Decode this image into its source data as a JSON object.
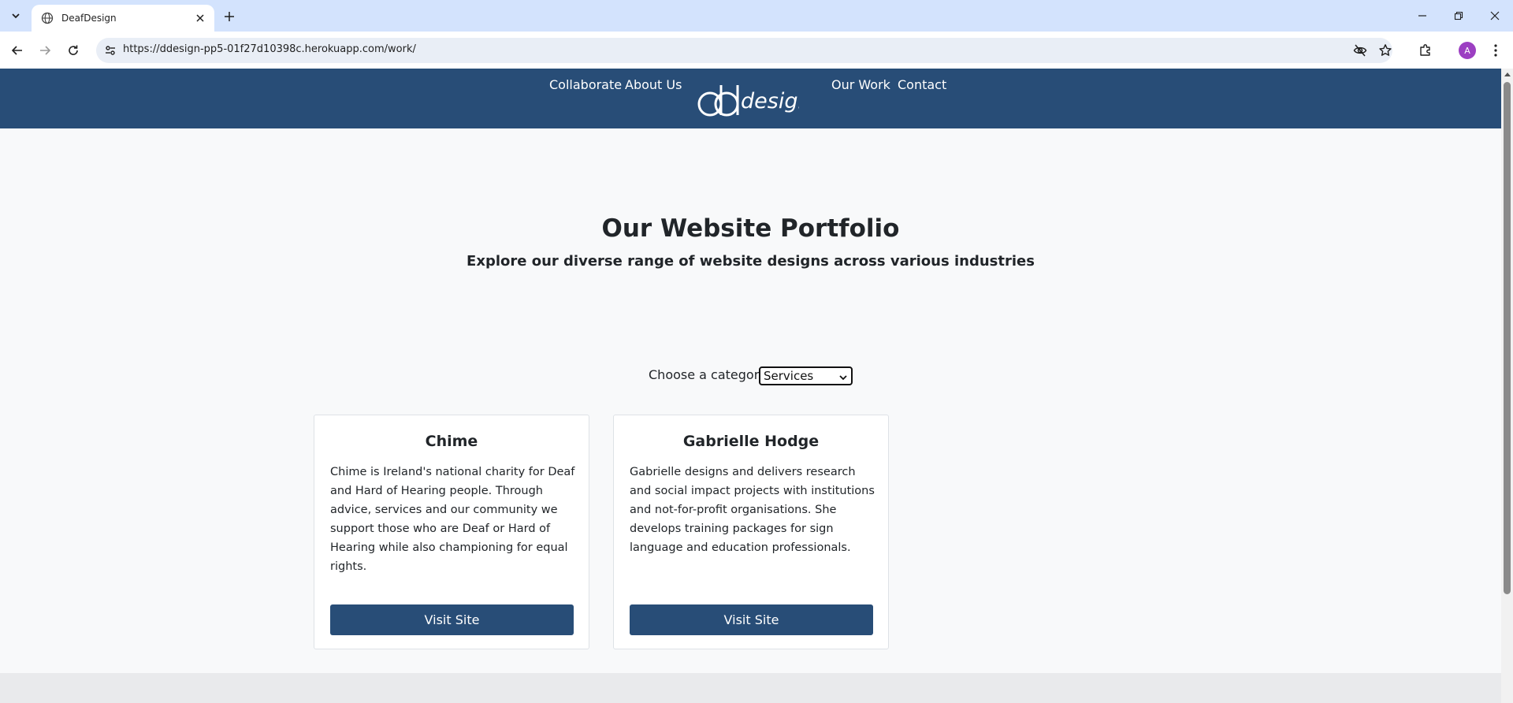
{
  "browser": {
    "tab_title": "DeafDesign",
    "url": "https://ddesign-pp5-01f27d10398c.herokuapp.com/work/",
    "profile_initial": "A"
  },
  "header": {
    "nav": {
      "collaborate": "Collaborate",
      "about": "About Us",
      "work": "Our Work",
      "contact": "Contact"
    },
    "logo_text": "design"
  },
  "hero": {
    "title": "Our Website Portfolio",
    "subtitle": "Explore our diverse range of website designs across various industries"
  },
  "filter": {
    "label": "Choose a category:",
    "selected": "Services"
  },
  "cards": [
    {
      "title": "Chime",
      "description": "Chime is Ireland's national charity for Deaf and Hard of Hearing people. Through advice, services and our community we support those who are Deaf or Hard of Hearing while also championing for equal rights.",
      "button": "Visit Site"
    },
    {
      "title": "Gabrielle Hodge",
      "description": "Gabrielle designs and delivers research and social impact projects with institutions and not-for-profit organisations. She develops training packages for sign language and education professionals.",
      "button": "Visit Site"
    }
  ],
  "colors": {
    "brand_navy": "#284d77",
    "page_bg": "#f8f9fa",
    "tabstrip": "#d3e3fd",
    "avatar": "#9c3fc2"
  }
}
